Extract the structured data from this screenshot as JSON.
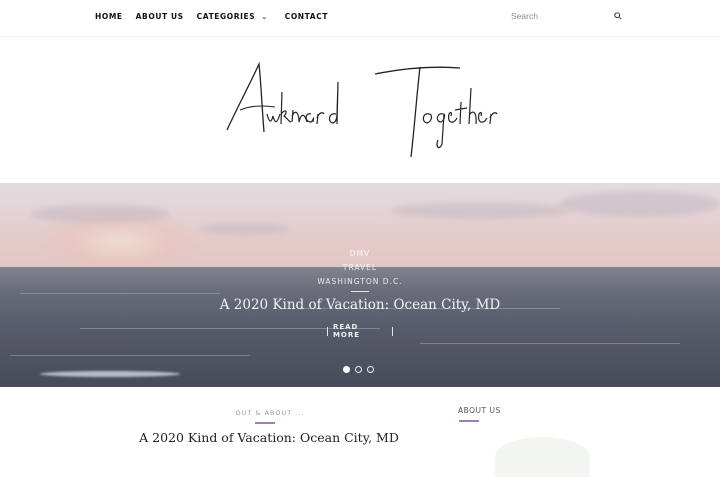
{
  "nav": {
    "items": [
      {
        "label": "HOME"
      },
      {
        "label": "ABOUT US"
      },
      {
        "label": "CATEGORIES"
      },
      {
        "label": "CONTACT"
      }
    ]
  },
  "search": {
    "placeholder": "Search",
    "icon": "search-icon"
  },
  "logo": {
    "text": "Awkward Together"
  },
  "hero": {
    "categories": [
      "DMV",
      "TRAVEL",
      "WASHINGTON D.C."
    ],
    "title": "A 2020 Kind of Vacation: Ocean City, MD",
    "read_more": "READ MORE",
    "slides_total": 3,
    "active_slide": 1
  },
  "post": {
    "category": "OUT & ABOUT ...",
    "title": "A 2020 Kind of Vacation: Ocean City, MD"
  },
  "sidebar": {
    "about_title": "ABOUT US"
  },
  "colors": {
    "accent": "#9a7fb0",
    "text": "#111111"
  }
}
